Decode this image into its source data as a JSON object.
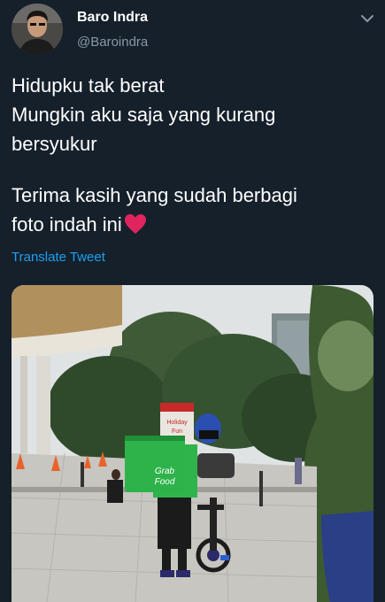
{
  "tweet": {
    "author": {
      "display_name": "Baro Indra",
      "handle": "@Baroindra",
      "avatar": "profile-photo"
    },
    "menu_icon": "chevron-down-icon",
    "text_lines": [
      "Hidupku tak berat",
      "Mungkin aku saja yang kurang",
      "bersyukur",
      "Terima kasih yang sudah berbagi",
      "foto indah ini"
    ],
    "emoji": "red-heart-emoji",
    "translate_label": "Translate Tweet",
    "photo": {
      "box_text_1": "Grab",
      "box_text_2": "Food",
      "sign_text_1": "Holiday",
      "sign_text_2": "Fun"
    }
  },
  "colors": {
    "background": "#15202b",
    "primary_text": "#ffffff",
    "secondary_text": "#8899a6",
    "link": "#1da1f2",
    "heart": "#e0245e",
    "grab_green": "#2db34a"
  }
}
